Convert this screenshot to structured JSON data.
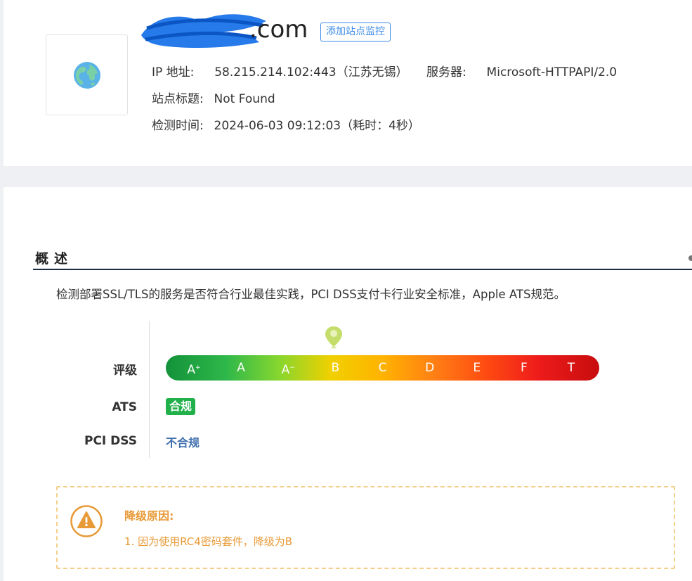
{
  "site": {
    "domain_suffix": ".com",
    "monitor_button": "添加站点监控",
    "logo_icon": "globe-icon"
  },
  "info": {
    "ip_label": "IP 地址:",
    "ip_value": "58.215.214.102:443（江苏无锡）",
    "server_label": "服务器:",
    "server_value": "Microsoft-HTTPAPI/2.0",
    "title_label": "站点标题:",
    "title_value": "Not Found",
    "time_label": "检测时间:",
    "time_value": "2024-06-03 09:12:03（耗时：4秒）"
  },
  "overview": {
    "title": "概述",
    "description": "检测部署SSL/TLS的服务是否符合行业最佳实践，PCI DSS支付卡行业安全标准，Apple ATS规范。",
    "rating_label": "评级",
    "grades": [
      {
        "base": "A",
        "mark": "+"
      },
      {
        "base": "A",
        "mark": ""
      },
      {
        "base": "A",
        "mark": "−"
      },
      {
        "base": "B",
        "mark": ""
      },
      {
        "base": "C",
        "mark": ""
      },
      {
        "base": "D",
        "mark": ""
      },
      {
        "base": "E",
        "mark": ""
      },
      {
        "base": "F",
        "mark": ""
      },
      {
        "base": "T",
        "mark": ""
      }
    ],
    "current_grade": "B",
    "ats_label": "ATS",
    "ats_value": "合规",
    "pci_label": "PCI DSS",
    "pci_value": "不合规"
  },
  "downgrade": {
    "title": "降级原因:",
    "reasons": [
      "1. 因为使用RC4密码套件，降级为B"
    ]
  },
  "colors": {
    "accent": "#3d8ce6",
    "compliant": "#22b04a",
    "non_compliant": "#3f6fae",
    "warning": "#e89a37"
  }
}
